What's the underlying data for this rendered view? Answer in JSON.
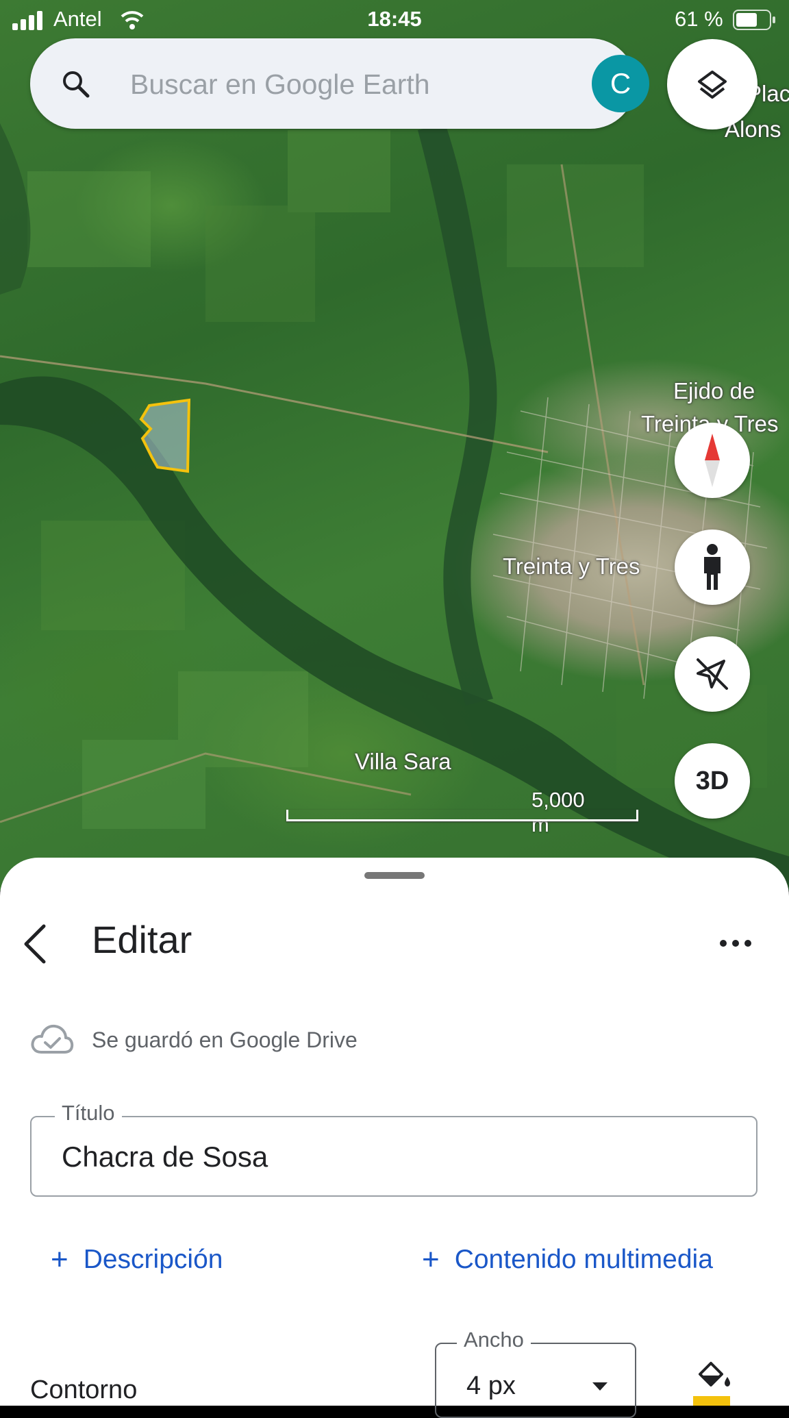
{
  "status_bar": {
    "carrier": "Antel",
    "time": "18:45",
    "battery": "61 %"
  },
  "search": {
    "placeholder": "Buscar en Google Earth",
    "avatar_letter": "C"
  },
  "map": {
    "labels": {
      "place_1": "Plac Alons",
      "place_1_line1": "Plac",
      "place_1_line2": "Alons",
      "ejido_line1": "Ejido de",
      "ejido_line2": "Treinta y Tres",
      "city": "Treinta y Tres",
      "villa": "Villa Sara"
    },
    "scale": "5,000 m",
    "buttons": {
      "three_d": "3D"
    }
  },
  "sheet": {
    "title": "Editar",
    "saved_status": "Se guardó en Google Drive",
    "title_field": {
      "label": "Título",
      "value": "Chacra de Sosa"
    },
    "add_description": "Descripción",
    "add_media": "Contenido multimedia",
    "outline": {
      "label": "Contorno",
      "width_label": "Ancho",
      "width_value": "4 px",
      "color": "#f4c20d"
    }
  },
  "colors": {
    "accent": "#1a57c8",
    "avatar": "#0a97a4",
    "polygon": "#f4c20d"
  }
}
